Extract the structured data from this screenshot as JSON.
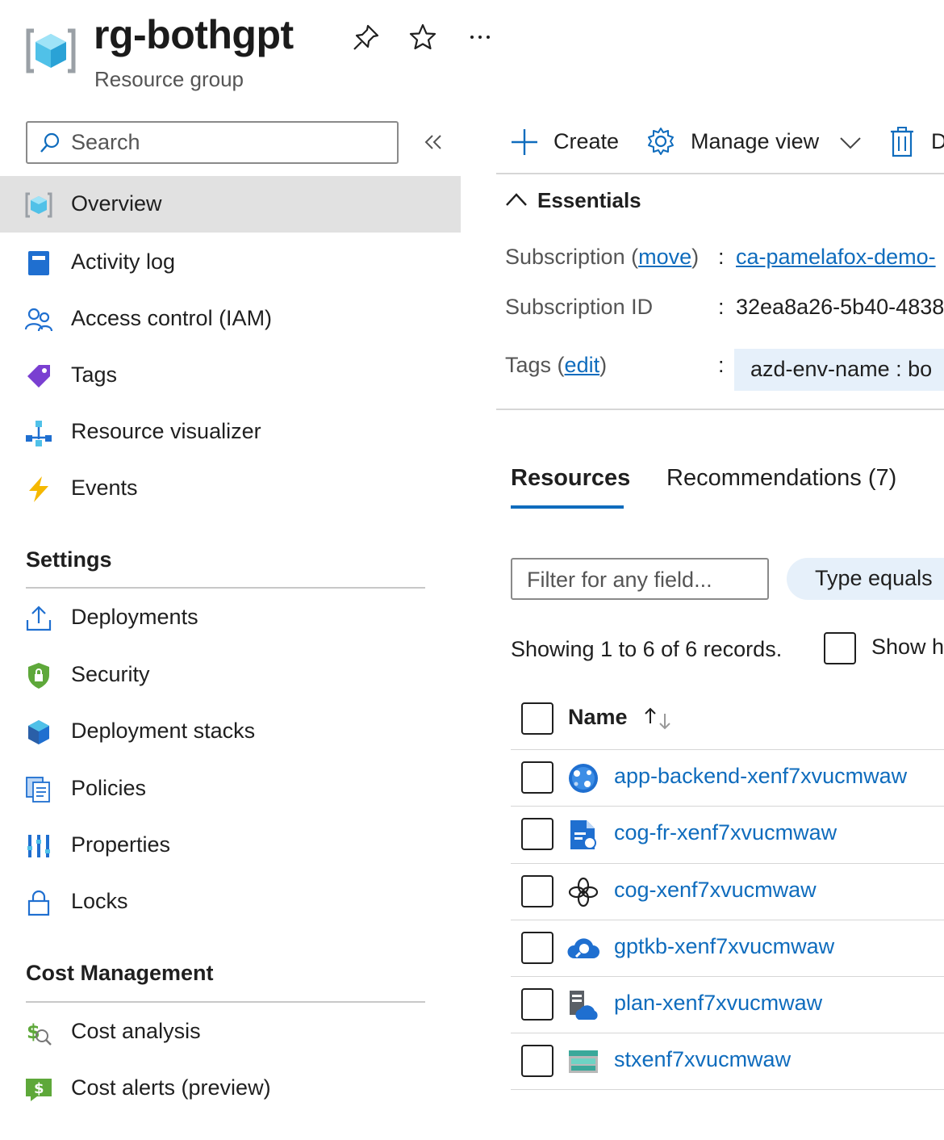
{
  "header": {
    "title": "rg-bothgpt",
    "subtitle": "Resource group",
    "icons": [
      "resource-group-icon",
      "pin-icon",
      "star-icon",
      "more-icon"
    ]
  },
  "sidebar": {
    "search_placeholder": "Search",
    "items": [
      {
        "label": "Overview",
        "icon": "resource-group-icon"
      },
      {
        "label": "Activity log",
        "icon": "activity-log-icon"
      },
      {
        "label": "Access control (IAM)",
        "icon": "people-icon"
      },
      {
        "label": "Tags",
        "icon": "tag-icon"
      },
      {
        "label": "Resource visualizer",
        "icon": "visualizer-icon"
      },
      {
        "label": "Events",
        "icon": "lightning-icon"
      }
    ],
    "settings_title": "Settings",
    "settings_items": [
      {
        "label": "Deployments",
        "icon": "upload-icon"
      },
      {
        "label": "Security",
        "icon": "shield-icon"
      },
      {
        "label": "Deployment stacks",
        "icon": "cube-icon"
      },
      {
        "label": "Policies",
        "icon": "policy-icon"
      },
      {
        "label": "Properties",
        "icon": "properties-icon"
      },
      {
        "label": "Locks",
        "icon": "lock-icon"
      }
    ],
    "cost_title": "Cost Management",
    "cost_items": [
      {
        "label": "Cost analysis",
        "icon": "cost-analysis-icon"
      },
      {
        "label": "Cost alerts (preview)",
        "icon": "cost-alert-icon"
      }
    ]
  },
  "toolbar": {
    "create": "Create",
    "manage_view": "Manage view",
    "delete_partial": "D"
  },
  "essentials": {
    "title": "Essentials",
    "subscription_label": "Subscription",
    "move_link": "move",
    "subscription_value": "ca-pamelafox-demo-",
    "subscription_id_label": "Subscription ID",
    "subscription_id_value": "32ea8a26-5b40-4838",
    "tags_label": "Tags",
    "edit_link": "edit",
    "tag_value": "azd-env-name : bo"
  },
  "tabs": {
    "resources": "Resources",
    "recommendations": "Recommendations (7)"
  },
  "filters": {
    "filter_placeholder": "Filter for any field...",
    "type_pill": "Type equals"
  },
  "records_text": "Showing 1 to 6 of 6 records.",
  "show_hidden": "Show h",
  "table": {
    "name_header": "Name",
    "rows": [
      {
        "name": "app-backend-xenf7xvucmwaw",
        "icon": "app-service-icon"
      },
      {
        "name": "cog-fr-xenf7xvucmwaw",
        "icon": "form-recognizer-icon"
      },
      {
        "name": "cog-xenf7xvucmwaw",
        "icon": "openai-icon"
      },
      {
        "name": "gptkb-xenf7xvucmwaw",
        "icon": "cognitive-search-icon"
      },
      {
        "name": "plan-xenf7xvucmwaw",
        "icon": "app-service-plan-icon"
      },
      {
        "name": "stxenf7xvucmwaw",
        "icon": "storage-account-icon"
      }
    ]
  },
  "colors": {
    "accent": "#0f6cbd",
    "active_nav": "#e1e1e1",
    "chip_bg": "#e6f0fa"
  }
}
